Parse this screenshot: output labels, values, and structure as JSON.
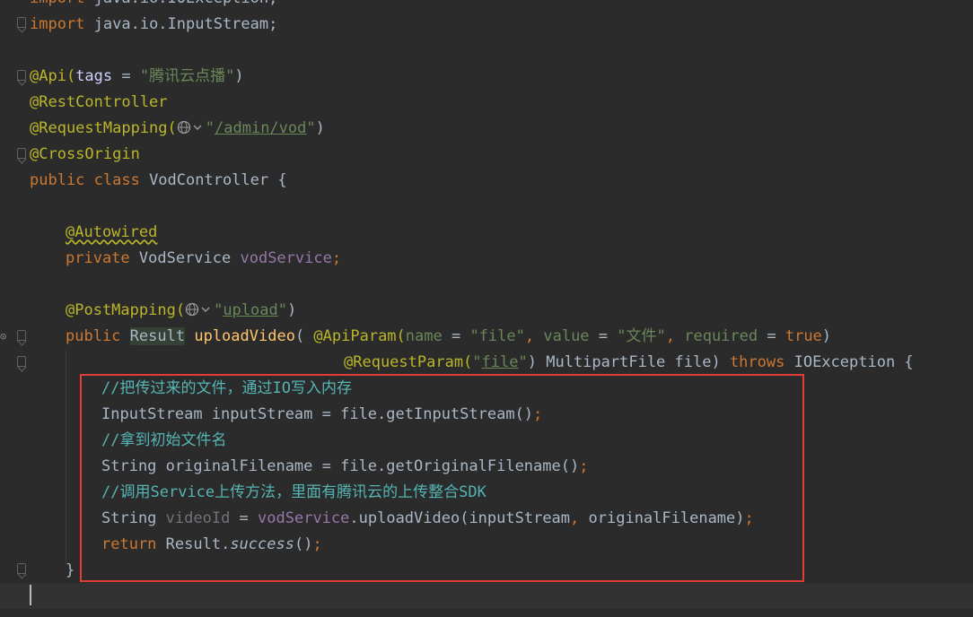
{
  "editor": {
    "lines": {
      "l0": {
        "kw": "import",
        "rest": " java.io.IOException;"
      },
      "l1": {
        "kw": "import",
        "rest": " java.io.InputStream;"
      },
      "l3": {
        "ann": "@Api(",
        "key": "tags",
        "eq": " = ",
        "str": "\"腾讯云点播\"",
        "close": ")"
      },
      "l4": {
        "ann": "@RestController"
      },
      "l5": {
        "ann": "@RequestMapping(",
        "q1": "\"",
        "link": "/admin/vod",
        "q2": "\"",
        "close": ")"
      },
      "l6": {
        "ann": "@CrossOrigin"
      },
      "l7": {
        "kw": "public class",
        "name": " VodController {"
      },
      "l9": {
        "ann": "@Autowired"
      },
      "l10": {
        "kw": "private",
        "type": " VodService ",
        "field": "vodService",
        "semi": ";"
      },
      "l12": {
        "ann": "@PostMapping(",
        "q1": "\"",
        "link": "upload",
        "q2": "\"",
        "close": ")"
      },
      "l13": {
        "kw": "public",
        "sp": " ",
        "type": "Result",
        "sp2": " ",
        "method": "uploadVideo",
        "open": "( ",
        "ann": "@ApiParam(",
        "k1": "name",
        "eq1": " = ",
        "v1": "\"file\"",
        "comma1": ", ",
        "k2": "value",
        "eq2": " = ",
        "v2": "\"文件\"",
        "comma2": ", ",
        "k3": "required",
        "eq3": " = ",
        "v3": "true",
        "close": ")"
      },
      "l14": {
        "ann": "@RequestParam(",
        "q1": "\"",
        "link": "file",
        "q2": "\"",
        "close": ")",
        "rest": " MultipartFile file) ",
        "kw": "throws",
        "exc": " IOException {"
      },
      "l15": {
        "cmt": "//把传过来的文件，通过IO写入内存"
      },
      "l16": {
        "text": "InputStream inputStream = file.getInputStream()",
        "semi": ";"
      },
      "l17": {
        "cmt": "//拿到初始文件名"
      },
      "l18": {
        "text": "String originalFilename = file.getOriginalFilename()",
        "semi": ";"
      },
      "l19": {
        "cmt_a": "//调用",
        "cmt_b": "Service",
        "cmt_c": "上传方法，里面有腾讯云的上传整合",
        "cmt_d": "SDK"
      },
      "l20": {
        "type": "String ",
        "var": "videoId",
        "eq": " = ",
        "field": "vodService",
        "call": ".uploadVideo(inputStream",
        "comma": ", ",
        "rest": "originalFilename)",
        "semi": ";"
      },
      "l21": {
        "kw": "return",
        "cls": " Result.",
        "method": "success",
        "end": "()",
        "semi": ";"
      },
      "l22": {
        "brace": "}"
      }
    }
  },
  "colors": {
    "background": "#2b2b2b",
    "keyword": "#cc7832",
    "string": "#6a8759",
    "annotation": "#bbb529",
    "comment": "#629755",
    "field": "#9876aa",
    "method": "#ffc66d",
    "highlight_box": "#e53a3a"
  },
  "icons": [
    "globe-icon",
    "chevron-down-icon",
    "bookmark-fold-icon"
  ]
}
